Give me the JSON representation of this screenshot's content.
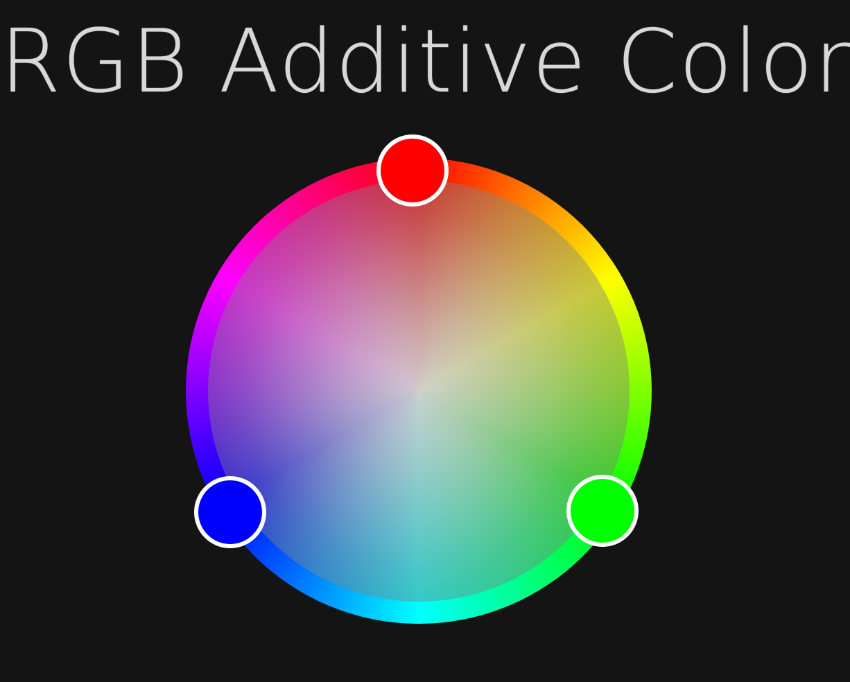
{
  "title": "RGB Additive Color",
  "wheel": {
    "handles": [
      {
        "name": "red",
        "color": "#ff0000"
      },
      {
        "name": "green",
        "color": "#00ff00"
      },
      {
        "name": "blue",
        "color": "#0000ff"
      }
    ]
  }
}
